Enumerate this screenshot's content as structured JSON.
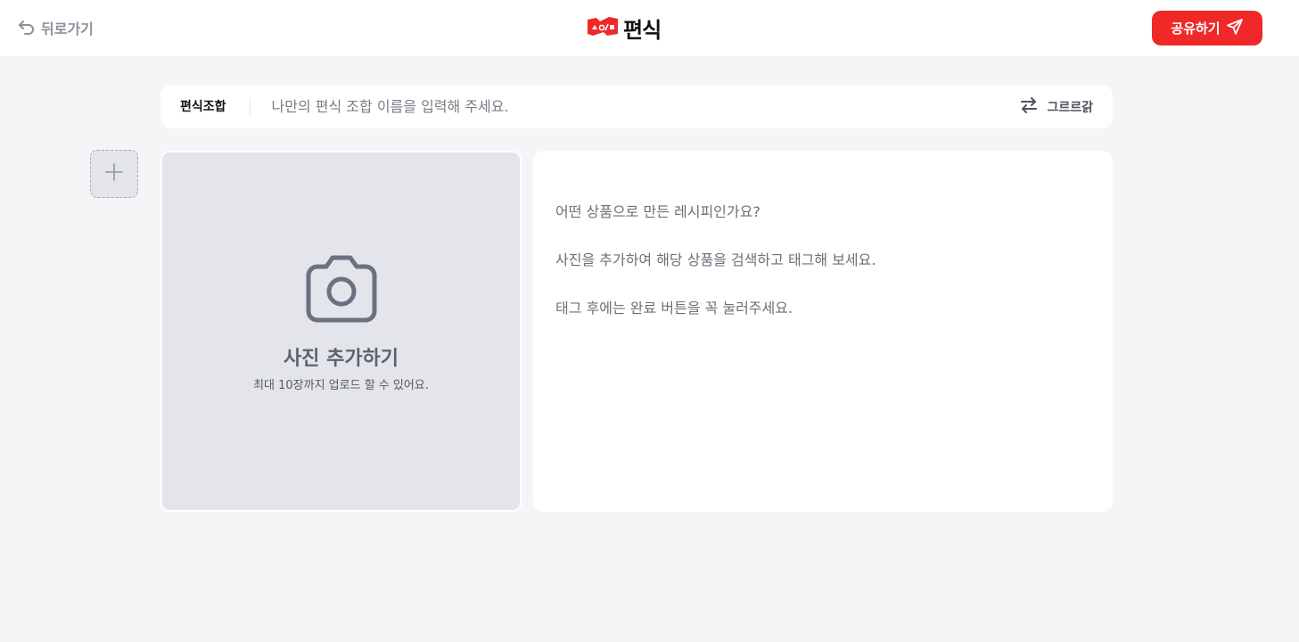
{
  "header": {
    "back_label": "뒤로가기",
    "logo_text": "편식",
    "share_label": "공유하기"
  },
  "name_bar": {
    "label": "편식조합",
    "placeholder": "나만의 편식 조합 이름을 입력해 주세요.",
    "rearrange_label": "그르르갉"
  },
  "photo": {
    "title": "사진 추가하기",
    "subtitle": "최대 10장까지 업로드 할 수 있어요."
  },
  "recipe": {
    "placeholder_lines": [
      "어떤 상품으로 만든 레시피인가요?",
      "사진을 추가하여 해당 상품을 검색하고 태그해 보세요.",
      "태그 후에는 완료 버튼을 꼭 눌러주세요."
    ]
  },
  "icons": {
    "back": "undo-arrow-icon",
    "share": "paper-plane-icon",
    "rearrange": "swap-arrows-icon",
    "add": "plus-icon",
    "camera": "camera-icon"
  },
  "colors": {
    "brand_red": "#f02828",
    "page_bg": "#f4f5f7",
    "photo_bg": "#e3e5ea"
  }
}
